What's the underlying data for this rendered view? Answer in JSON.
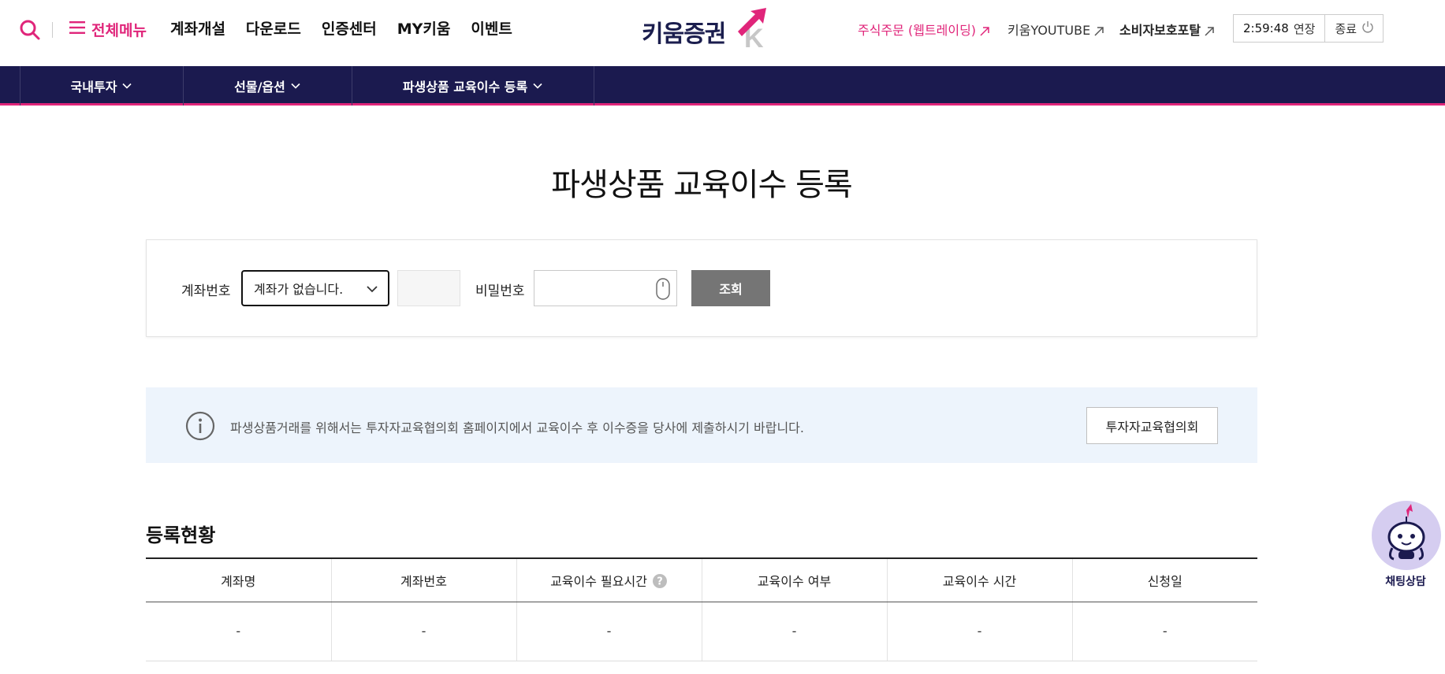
{
  "header": {
    "all_menu_label": "전체메뉴",
    "gnb": [
      "계좌개설",
      "다운로드",
      "인증센터",
      "MY키움",
      "이벤트"
    ],
    "logo_text": "키움증권",
    "util_trade": "주식주문 (웹트레이딩)",
    "util_youtube": "키움YOUTUBE",
    "util_consumer": "소비자보호포탈",
    "timer": "2:59:48",
    "extend_label": "연장",
    "logout_label": "종료"
  },
  "nav": {
    "items": [
      "국내투자",
      "선물/옵션",
      "파생상품 교육이수 등록"
    ]
  },
  "page": {
    "title": "파생상품 교육이수 등록"
  },
  "search": {
    "account_label": "계좌번호",
    "account_value": "계좌가 없습니다.",
    "password_label": "비밀번호",
    "password_value": "",
    "query_button": "조회"
  },
  "info": {
    "text": "파생상품거래를 위해서는 투자자교육협의회 홈페이지에서 교육이수 후 이수증을 당사에 제출하시기 바랍니다.",
    "button": "투자자교육협의회"
  },
  "registration": {
    "title": "등록현황",
    "columns": [
      "계좌명",
      "계좌번호",
      "교육이수 필요시간",
      "교육이수 여부",
      "교육이수 시간",
      "신청일"
    ],
    "rows": [
      [
        "-",
        "-",
        "-",
        "-",
        "-",
        "-"
      ]
    ]
  },
  "chatbot": {
    "label": "채팅상담"
  },
  "colors": {
    "brand_pink": "#e0257a",
    "navy": "#1b1a4f",
    "info_bg": "#edf4fc",
    "query_btn": "#757575"
  }
}
